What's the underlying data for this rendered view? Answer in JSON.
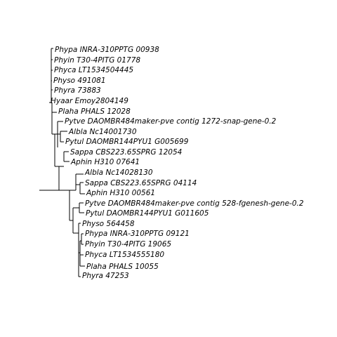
{
  "tree": {
    "line_color": "#000000",
    "tips": [
      "Phypa INRA-310PPTG 00938",
      "Phyin T30-4PITG 01778",
      "Phyca LT1534504445",
      "Physo 491081",
      "Phyra 73883",
      "Hyaar Emoy2804149",
      "Plaha PHALS 12028",
      "Pytve DAOMBR484maker-pve contig 1272-snap-gene-0.2",
      "Albla Nc14001730",
      "Pytul DAOMBR144PYU1 G005699",
      "Sappa CBS223.65SPRG 12054",
      "Aphin H310 07641",
      "Albla Nc14028130",
      "Sappa CBS223.65SPRG 04114",
      "Aphin H310 00561",
      "Pytve DAOMBR484maker-pve contig 528-fgenesh-gene-0.2",
      "Pytul DAOMBR144PYU1 G011605",
      "Physo 564458",
      "Phypa INRA-310PPTG 09121",
      "Phyin T30-4PITG 19065",
      "Phyca LT1534555180",
      "Plaha PHALS 10055",
      "Phyra 47253"
    ]
  }
}
